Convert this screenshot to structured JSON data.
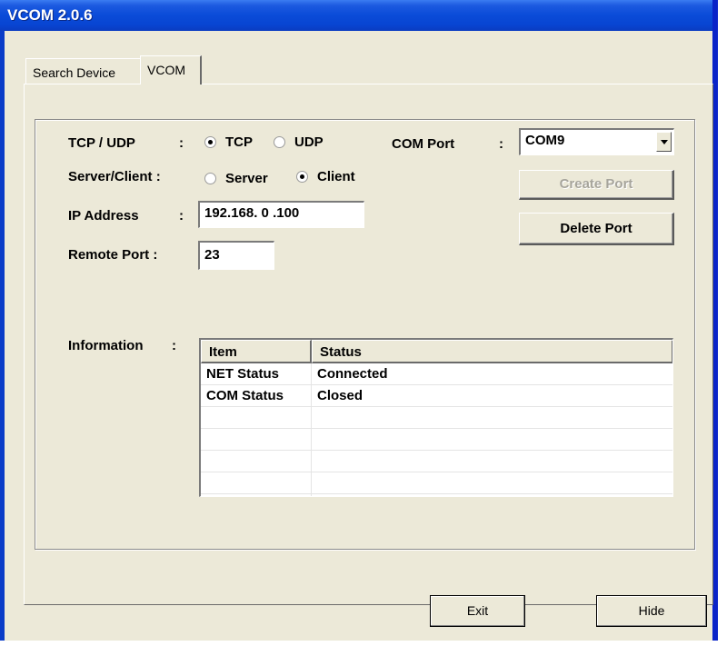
{
  "window": {
    "title": "VCOM 2.0.6"
  },
  "tabs": [
    {
      "label": "Search Device",
      "active": false
    },
    {
      "label": "VCOM",
      "active": true
    }
  ],
  "form": {
    "protocol_label": "TCP / UDP",
    "protocol_colon": ":",
    "protocol_options": [
      {
        "label": "TCP",
        "selected": true
      },
      {
        "label": "UDP",
        "selected": false
      }
    ],
    "mode_label": "Server/Client :",
    "mode_options": [
      {
        "label": "Server",
        "selected": false
      },
      {
        "label": "Client",
        "selected": true
      }
    ],
    "ip_label": "IP Address",
    "ip_colon": ":",
    "ip_value": "192.168. 0 .100",
    "remote_port_label": "Remote Port :",
    "remote_port_value": "23",
    "com_port_label": "COM Port",
    "com_port_colon": ":",
    "com_port_value": "COM9",
    "information_label": "Information",
    "information_colon": ":"
  },
  "buttons": {
    "create_port": "Create Port",
    "delete_port": "Delete Port",
    "exit": "Exit",
    "hide": "Hide"
  },
  "info_table": {
    "columns": [
      "Item",
      "Status"
    ],
    "rows": [
      [
        "NET Status",
        "Connected"
      ],
      [
        "COM Status",
        "Closed"
      ]
    ]
  }
}
